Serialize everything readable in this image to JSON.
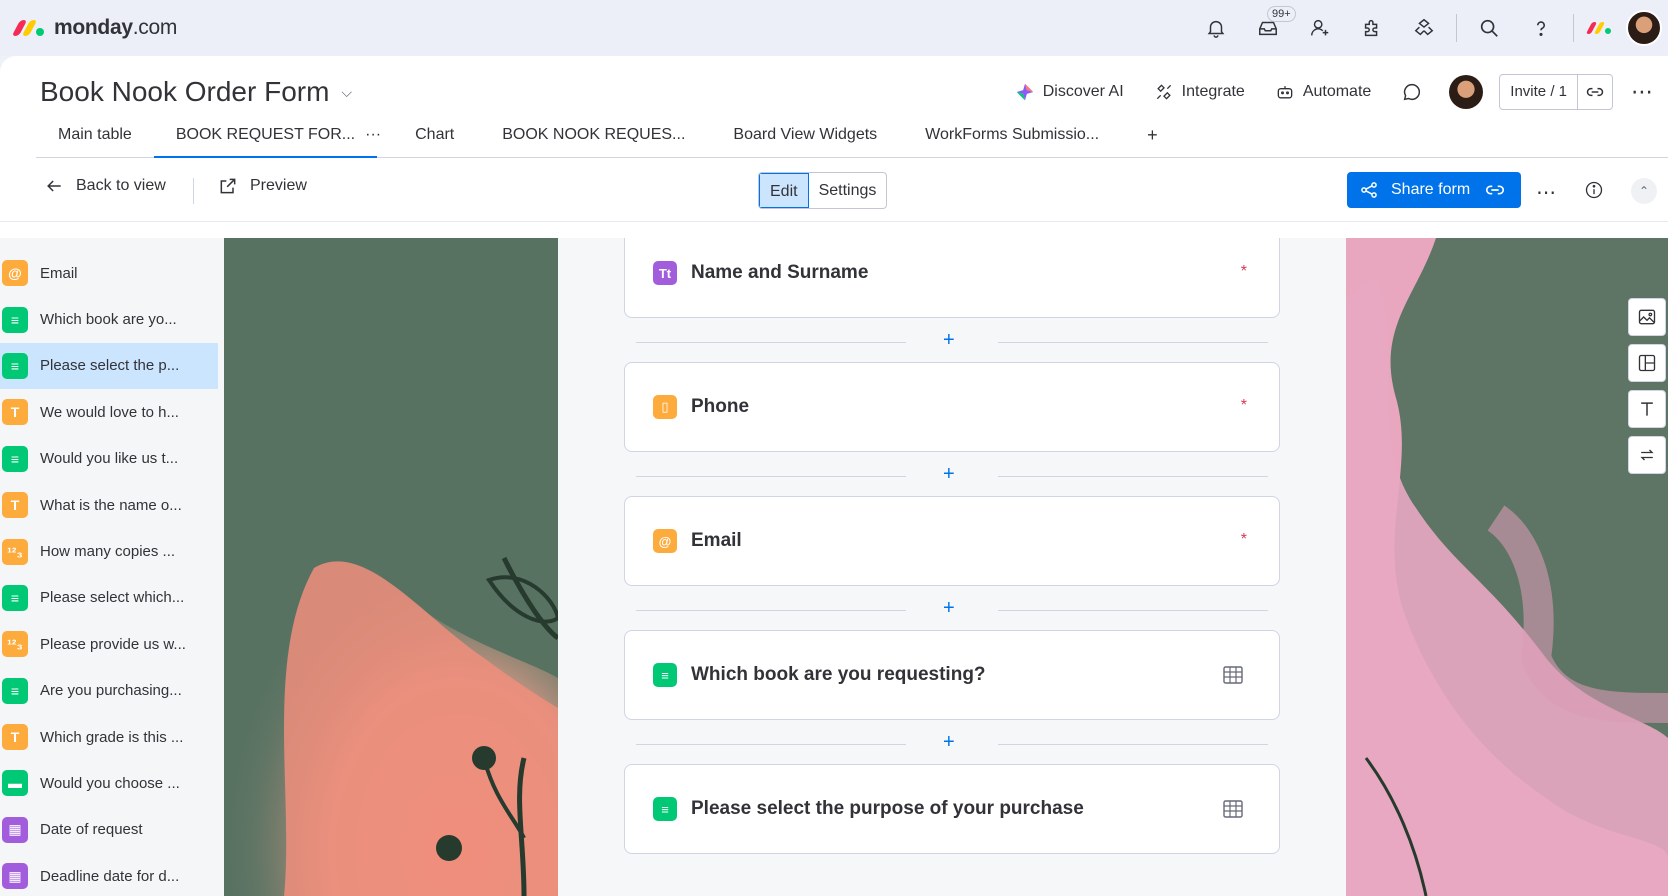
{
  "app": {
    "logo_brand": "monday",
    "logo_suffix": ".com",
    "notifications_badge": "99+"
  },
  "board": {
    "title": "Book Nook Order Form",
    "actions": {
      "discover_ai": "Discover AI",
      "integrate": "Integrate",
      "automate": "Automate",
      "invite": "Invite / 1"
    },
    "tabs": [
      {
        "label": "Main table"
      },
      {
        "label": "BOOK REQUEST FOR..."
      },
      {
        "label": "Chart"
      },
      {
        "label": "BOOK NOOK REQUES..."
      },
      {
        "label": "Board View Widgets"
      },
      {
        "label": "WorkForms Submissio..."
      }
    ],
    "tab_more": "···",
    "tab_add": "+"
  },
  "toolbar": {
    "back_label": "Back to view",
    "preview_label": "Preview",
    "edit_label": "Edit",
    "settings_label": "Settings",
    "share_label": "Share form"
  },
  "sidebar": {
    "items": [
      {
        "label": "Email",
        "icon": "at-icon",
        "color": "#fdab3d",
        "glyph": "@"
      },
      {
        "label": "Which book are yo...",
        "icon": "dropdown-column-icon",
        "color": "#00c875",
        "glyph": "≡"
      },
      {
        "label": "Please select the p...",
        "icon": "dropdown-column-icon",
        "color": "#00c875",
        "glyph": "≡"
      },
      {
        "label": "We would love to h...",
        "icon": "text-column-icon",
        "color": "#fdab3d",
        "glyph": "T"
      },
      {
        "label": "Would you like us t...",
        "icon": "dropdown-column-icon",
        "color": "#00c875",
        "glyph": "≡"
      },
      {
        "label": "What is the name o...",
        "icon": "text-column-icon",
        "color": "#fdab3d",
        "glyph": "T"
      },
      {
        "label": "How many copies ...",
        "icon": "numbers-column-icon",
        "color": "#fdab3d",
        "glyph": "¹²₃"
      },
      {
        "label": "Please select which...",
        "icon": "dropdown-column-icon",
        "color": "#00c875",
        "glyph": "≡"
      },
      {
        "label": "Please provide us w...",
        "icon": "numbers-column-icon",
        "color": "#fdab3d",
        "glyph": "¹²₃"
      },
      {
        "label": "Are you purchasing...",
        "icon": "dropdown-column-icon",
        "color": "#00c875",
        "glyph": "≡"
      },
      {
        "label": "Which grade is this ...",
        "icon": "text-column-icon",
        "color": "#fdab3d",
        "glyph": "T"
      },
      {
        "label": "Would you choose ...",
        "icon": "status-column-icon",
        "color": "#00c875",
        "glyph": "▬"
      },
      {
        "label": "Date of request",
        "icon": "date-column-icon",
        "color": "#a25ddc",
        "glyph": "▦"
      },
      {
        "label": "Deadline date for d...",
        "icon": "date-column-icon",
        "color": "#a25ddc",
        "glyph": "▦"
      }
    ],
    "active_index": 2
  },
  "form": {
    "questions": [
      {
        "title": "Name and Surname",
        "icon": "name-column-icon",
        "color": "#a25ddc",
        "glyph": "Tt",
        "required": true
      },
      {
        "title": "Phone",
        "icon": "phone-column-icon",
        "color": "#fdab3d",
        "glyph": "▯",
        "required": true
      },
      {
        "title": "Email",
        "icon": "at-icon",
        "color": "#fdab3d",
        "glyph": "@",
        "required": true
      },
      {
        "title": "Which book are you requesting?",
        "icon": "dropdown-column-icon",
        "color": "#00c875",
        "glyph": "≡",
        "required": false
      },
      {
        "title": "Please select the purpose of your purchase",
        "icon": "dropdown-column-icon",
        "color": "#00c875",
        "glyph": "≡",
        "required": false
      }
    ],
    "required_mark": "*",
    "add_symbol": "+"
  },
  "colors": {
    "primary": "#0073ea",
    "selected_bg": "#cce5ff",
    "required": "#d83a52"
  }
}
